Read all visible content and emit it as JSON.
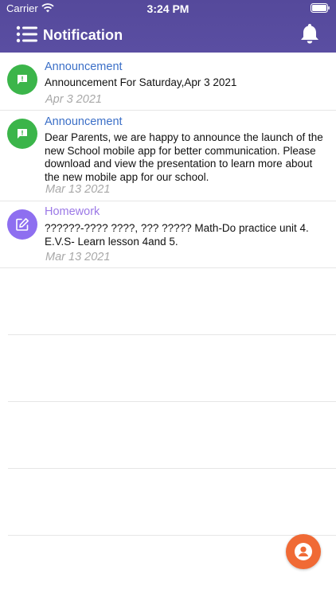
{
  "status_bar": {
    "carrier": "Carrier",
    "time": "3:24 PM"
  },
  "nav": {
    "title": "Notification",
    "menu_icon": "menu-list-icon",
    "bell_icon": "bell-icon"
  },
  "notifications": [
    {
      "type": "Announcement",
      "message": "Announcement For Saturday,Apr 3 2021",
      "date": "Apr  3 2021",
      "icon": "announcement-icon",
      "color": "#3bb54a"
    },
    {
      "type": "Announcement",
      "message": "Dear Parents, we are happy to announce the launch of the new School mobile app for better communication. Please download and view the presentation to learn more about the new mobile app for our school.",
      "date": "Mar 13 2021",
      "icon": "announcement-icon",
      "color": "#3bb54a"
    },
    {
      "type": "Homework",
      "message": "??????-???? ????, ??? ????? Math-Do practice unit 4. E.V.S- Learn lesson 4and 5.",
      "date": "Mar 13 2021",
      "icon": "edit-icon",
      "color": "#8e6ff0"
    }
  ],
  "fab": {
    "icon": "user-icon",
    "color": "#f06a35"
  },
  "theme": {
    "header_bg": "#55499b",
    "type_announcement_color": "#3b6fc7",
    "type_homework_color": "#9b78e6",
    "date_color": "#a8a8a8"
  }
}
